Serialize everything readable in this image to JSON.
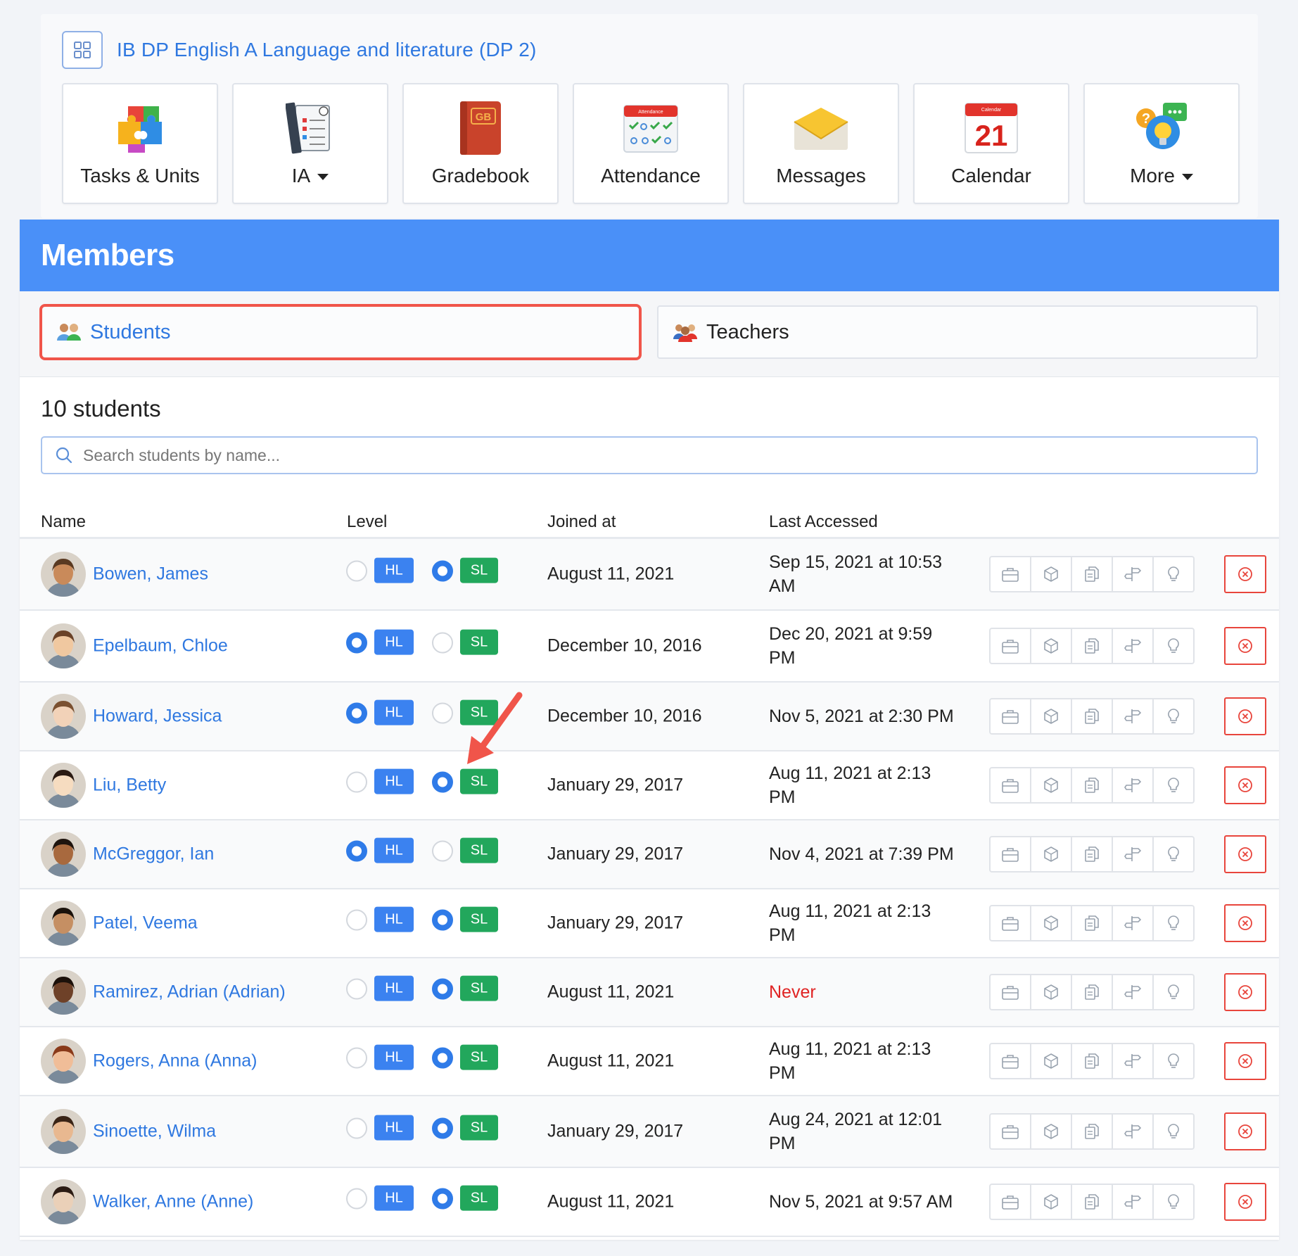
{
  "course": {
    "title": "IB DP English A Language and literature (DP 2)",
    "tiles": [
      {
        "label": "Tasks & Units",
        "icon": "puzzle-icon",
        "has_caret": false
      },
      {
        "label": "IA",
        "icon": "checklist-icon",
        "has_caret": true
      },
      {
        "label": "Gradebook",
        "icon": "gradebook-icon",
        "has_caret": false
      },
      {
        "label": "Attendance",
        "icon": "attendance-icon",
        "has_caret": false
      },
      {
        "label": "Messages",
        "icon": "envelope-icon",
        "has_caret": false
      },
      {
        "label": "Calendar",
        "icon": "calendar-icon",
        "has_caret": false
      },
      {
        "label": "More",
        "icon": "help-lightbulb-icon",
        "has_caret": true
      }
    ],
    "gradebook_icon_text": "GB",
    "attendance_icon_text": "Attendance",
    "calendar_icon_text": "Calendar",
    "calendar_day": "21"
  },
  "members": {
    "title": "Members",
    "tabs": {
      "students": "Students",
      "teachers": "Teachers"
    },
    "count_label": "10 students",
    "search_placeholder": "Search students by name...",
    "columns": {
      "name": "Name",
      "level": "Level",
      "joined": "Joined at",
      "accessed": "Last Accessed"
    },
    "level_labels": {
      "hl": "HL",
      "sl": "SL"
    },
    "students": [
      {
        "name": "Bowen, James",
        "level": "SL",
        "joined": "August 11, 2021",
        "accessed": "Sep 15, 2021 at 10:53 AM"
      },
      {
        "name": "Epelbaum, Chloe",
        "level": "HL",
        "joined": "December 10, 2016",
        "accessed": "Dec 20, 2021 at 9:59 PM"
      },
      {
        "name": "Howard, Jessica",
        "level": "HL",
        "joined": "December 10, 2016",
        "accessed": "Nov 5, 2021 at 2:30 PM"
      },
      {
        "name": "Liu, Betty",
        "level": "SL",
        "joined": "January 29, 2017",
        "accessed": "Aug 11, 2021 at 2:13 PM"
      },
      {
        "name": "McGreggor, Ian",
        "level": "HL",
        "joined": "January 29, 2017",
        "accessed": "Nov 4, 2021 at 7:39 PM"
      },
      {
        "name": "Patel, Veema",
        "level": "SL",
        "joined": "January 29, 2017",
        "accessed": "Aug 11, 2021 at 2:13 PM"
      },
      {
        "name": "Ramirez, Adrian (Adrian)",
        "level": "SL",
        "joined": "August 11, 2021",
        "accessed": "Never"
      },
      {
        "name": "Rogers, Anna (Anna)",
        "level": "SL",
        "joined": "August 11, 2021",
        "accessed": "Aug 11, 2021 at 2:13 PM"
      },
      {
        "name": "Sinoette, Wilma",
        "level": "SL",
        "joined": "January 29, 2017",
        "accessed": "Aug 24, 2021 at 12:01 PM"
      },
      {
        "name": "Walker, Anne (Anne)",
        "level": "SL",
        "joined": "August 11, 2021",
        "accessed": "Nov 5, 2021 at 9:57 AM"
      }
    ],
    "row_actions": [
      "briefcase-icon",
      "cube-icon",
      "documents-icon",
      "signpost-icon",
      "lightbulb-icon"
    ],
    "delete_action": "remove-circle-icon"
  },
  "colors": {
    "accent": "#2f78e0",
    "header": "#4a90f8",
    "hl_badge": "#3b82f0",
    "sl_badge": "#22a75c",
    "never": "#e02424",
    "highlight": "#f0554a"
  }
}
